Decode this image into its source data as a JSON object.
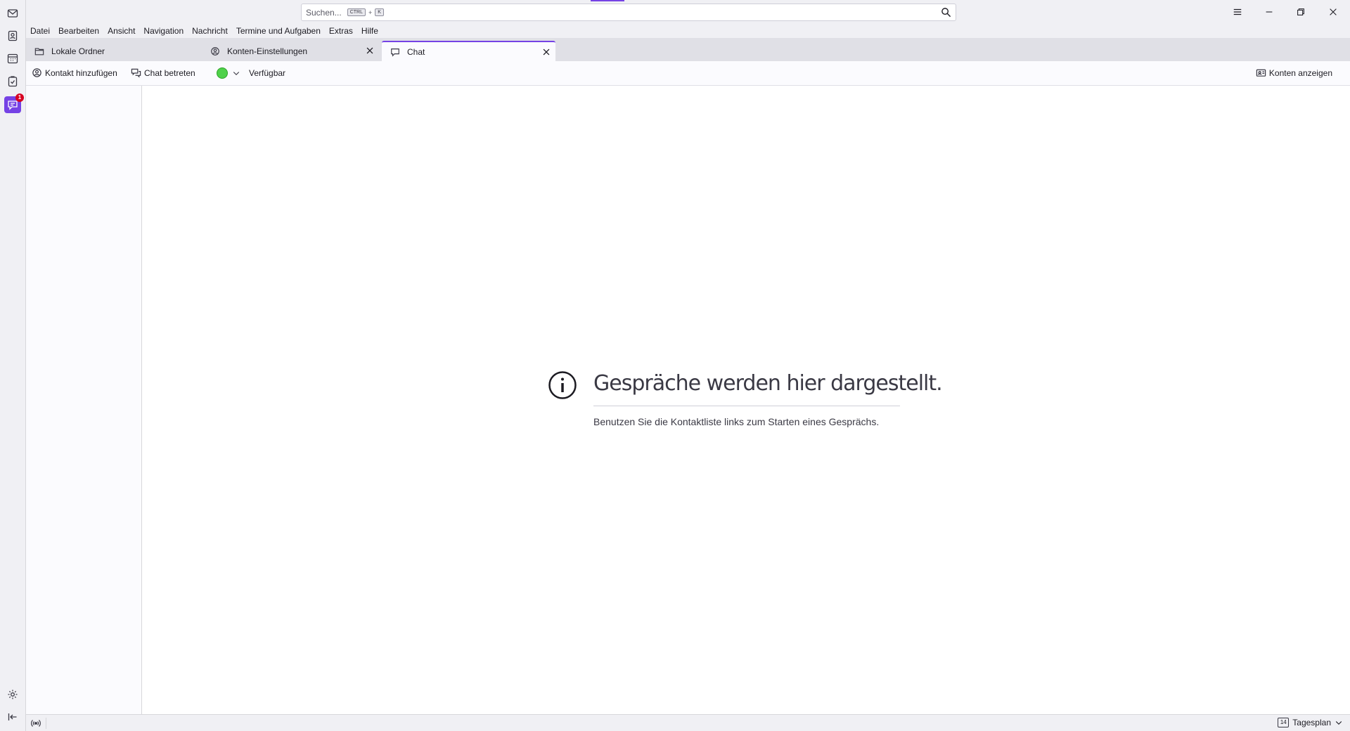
{
  "spaces": {
    "mail_icon": "envelope-icon",
    "addressbook_icon": "addressbook-icon",
    "calendar_icon": "calendar-icon",
    "tasks_icon": "tasks-icon",
    "chat_icon": "chat-icon",
    "chat_badge": "1",
    "settings_icon": "gear-icon",
    "collapse_icon": "collapse-icon"
  },
  "titlebar": {
    "search_placeholder": "Suchen...",
    "shortcut_mod": "CTRL",
    "shortcut_plus": "+",
    "shortcut_key": "K"
  },
  "menubar": {
    "items": [
      "Datei",
      "Bearbeiten",
      "Ansicht",
      "Navigation",
      "Nachricht",
      "Termine und Aufgaben",
      "Extras",
      "Hilfe"
    ]
  },
  "tabs": [
    {
      "label": "Lokale Ordner",
      "icon": "folder-icon"
    },
    {
      "label": "Konten-Einstellungen",
      "icon": "account-settings-icon"
    },
    {
      "label": "Chat",
      "icon": "chat-icon"
    }
  ],
  "chat_toolbar": {
    "add_contact": "Kontakt hinzufügen",
    "join_chat": "Chat betreten",
    "status": "Verfügbar",
    "show_accounts": "Konten anzeigen"
  },
  "conversation": {
    "heading": "Gespräche werden hier dargestellt.",
    "description": "Benutzen Sie die Kontaktliste links zum Starten eines Gesprächs."
  },
  "statusbar": {
    "today_pane_day": "14",
    "today_pane_label": "Tagesplan"
  },
  "colors": {
    "accent": "#7542e5",
    "status_available": "#4fd14a"
  }
}
